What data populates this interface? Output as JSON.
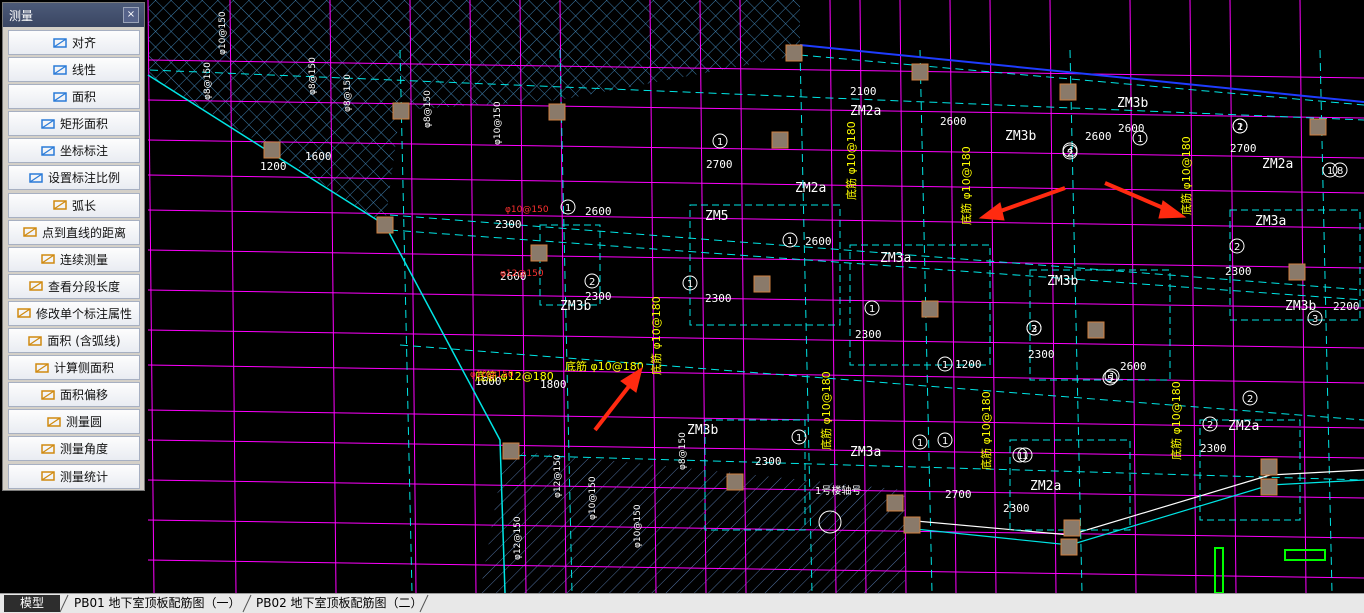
{
  "panel": {
    "title": "测量",
    "close": "×",
    "items": [
      {
        "label": "对齐",
        "icon": "aligned-dimension-icon"
      },
      {
        "label": "线性",
        "icon": "linear-dimension-icon"
      },
      {
        "label": "面积",
        "icon": "area-icon"
      },
      {
        "label": "矩形面积",
        "icon": "rectangle-area-icon"
      },
      {
        "label": "坐标标注",
        "icon": "coordinate-icon"
      },
      {
        "label": "设置标注比例",
        "icon": "scale-icon"
      },
      {
        "label": "弧长",
        "icon": "arc-length-icon"
      },
      {
        "label": "点到直线的距离",
        "icon": "point-to-line-icon"
      },
      {
        "label": "连续测量",
        "icon": "continuous-measure-icon"
      },
      {
        "label": "查看分段长度",
        "icon": "segment-length-icon"
      },
      {
        "label": "修改单个标注属性",
        "icon": "edit-dimension-icon"
      },
      {
        "label": "面积 (含弧线)",
        "icon": "arc-area-icon"
      },
      {
        "label": "计算侧面积",
        "icon": "side-area-icon"
      },
      {
        "label": "面积偏移",
        "icon": "area-offset-icon"
      },
      {
        "label": "测量圆",
        "icon": "measure-circle-icon"
      },
      {
        "label": "测量角度",
        "icon": "measure-angle-icon"
      },
      {
        "label": "测量统计",
        "icon": "measure-statistics-icon"
      }
    ]
  },
  "tabs": {
    "model": "模型",
    "layout1": "PB01 地下室顶板配筋图（一）",
    "layout2": "PB02 地下室顶板配筋图（二）"
  },
  "drawing": {
    "zm_labels": [
      "ZM2a",
      "ZM3b",
      "ZM2a",
      "ZM2a",
      "ZM5",
      "ZM3a",
      "ZM3a",
      "ZM3b",
      "ZM3b",
      "ZM3b",
      "ZM3b",
      "ZM3a",
      "ZM2a",
      "ZM2a",
      "ZM3b"
    ],
    "dims": [
      "2100",
      "2600",
      "2700",
      "2700",
      "2600",
      "2600",
      "2600",
      "2600",
      "2300",
      "2300",
      "2200",
      "2300",
      "2300",
      "2700",
      "2300",
      "2300",
      "2300",
      "2300",
      "2300",
      "2600",
      "2600",
      "1200",
      "1200",
      "1600",
      "1600",
      "1800"
    ],
    "rebar_labels": [
      "底筋 φ10@180",
      "底筋 φ10@180",
      "底筋 φ10@180",
      "底筋 φ10@180",
      "底筋 φ10@180",
      "底筋 φ10@180",
      "底筋 φ10@180",
      "底筋 φ10@180",
      "底筋 φ12@180"
    ],
    "small_notes": [
      "φ8@150",
      "φ8@150",
      "φ10@150",
      "φ8@150",
      "φ10@150",
      "φ8@150",
      "φ8@150",
      "φ12@150",
      "φ10@150",
      "φ10@150",
      "φ12@150"
    ],
    "circle_marks": [
      "1",
      "1",
      "1",
      "1",
      "1",
      "1",
      "1",
      "1",
      "1",
      "1",
      "1",
      "1",
      "2",
      "2",
      "2",
      "2",
      "2",
      "3",
      "3",
      "4",
      "5",
      "8",
      "1",
      "2",
      "1",
      "1",
      "2"
    ],
    "red_notes": [
      "φ10@150",
      "φ12@150",
      "φ10@150"
    ],
    "axis_label": "1号楼轴号",
    "colors": {
      "background": "#000000",
      "magenta": "#ff00ff",
      "cyan": "#00e5e5",
      "yellow": "#ffff00",
      "white": "#ffffff",
      "blue": "#1e3cff",
      "column": "#8a7a6a",
      "arrow": "#ff2a10",
      "green": "#00ff00"
    }
  }
}
